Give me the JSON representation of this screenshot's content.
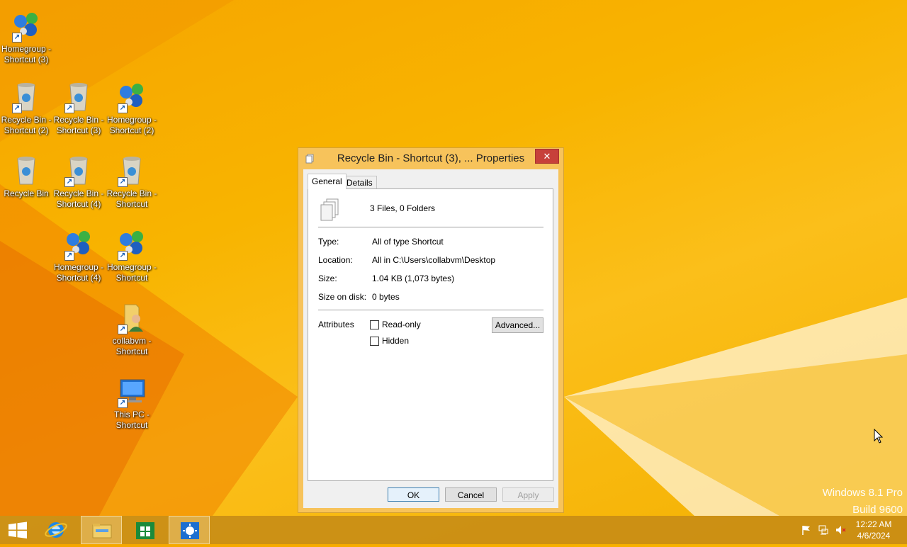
{
  "desktop": {
    "icons": [
      {
        "label": "Homegroup - Shortcut (3)",
        "kind": "homegroup-icon"
      },
      {
        "label": "Recycle Bin - Shortcut (2)",
        "kind": "recycle-bin-icon"
      },
      {
        "label": "Recycle Bin - Shortcut (3)",
        "kind": "recycle-bin-icon"
      },
      {
        "label": "Homegroup - Shortcut (2)",
        "kind": "homegroup-icon"
      },
      {
        "label": "Recycle Bin",
        "kind": "recycle-bin-icon"
      },
      {
        "label": "Recycle Bin - Shortcut (4)",
        "kind": "recycle-bin-icon"
      },
      {
        "label": "Recycle Bin - Shortcut",
        "kind": "recycle-bin-icon"
      },
      {
        "label": "Homegroup - Shortcut (4)",
        "kind": "homegroup-icon"
      },
      {
        "label": "Homegroup - Shortcut",
        "kind": "homegroup-icon"
      },
      {
        "label": "collabvm - Shortcut",
        "kind": "user-folder-icon"
      },
      {
        "label": "This PC - Shortcut",
        "kind": "computer-icon"
      }
    ],
    "watermark": {
      "line1": "Windows 8.1 Pro",
      "line2": "Build 9600"
    }
  },
  "dialog": {
    "title": "Recycle Bin - Shortcut (3), ... Properties",
    "close_glyph": "✕",
    "tabs": [
      {
        "label": "General"
      },
      {
        "label": "Details"
      }
    ],
    "summary": "3 Files, 0 Folders",
    "fields": {
      "type_label": "Type:",
      "type_value": "All of type Shortcut",
      "location_label": "Location:",
      "location_value": "All in C:\\Users\\collabvm\\Desktop",
      "size_label": "Size:",
      "size_value": "1.04 KB (1,073 bytes)",
      "size_on_disk_label": "Size on disk:",
      "size_on_disk_value": "0 bytes"
    },
    "attributes": {
      "label": "Attributes",
      "readonly_label": "Read-only",
      "hidden_label": "Hidden",
      "advanced_label": "Advanced..."
    },
    "buttons": {
      "ok": "OK",
      "cancel": "Cancel",
      "apply": "Apply"
    }
  },
  "taskbar": {
    "items": [
      "start-icon",
      "internet-explorer-icon",
      "file-explorer-icon",
      "store-icon",
      "control-panel-icon"
    ],
    "clock": {
      "time": "12:22 AM",
      "date": "4/6/2024"
    }
  }
}
